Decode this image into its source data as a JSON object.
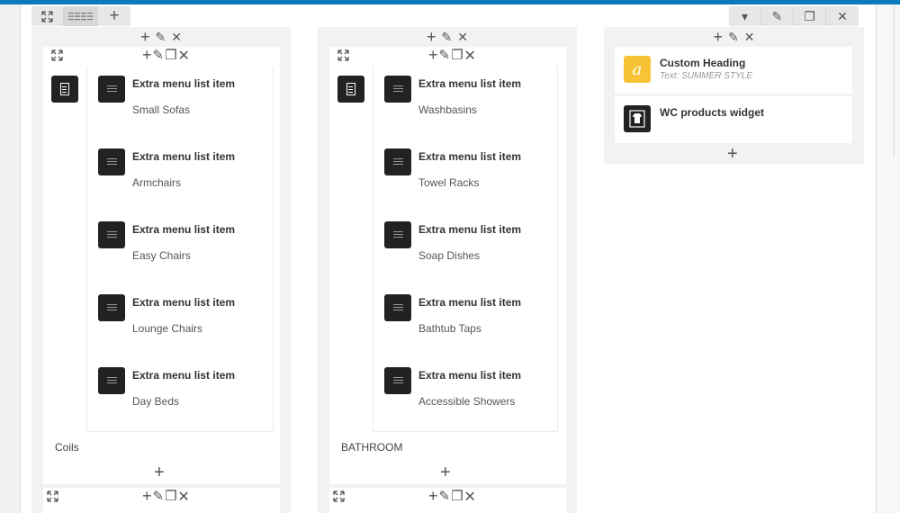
{
  "row_controls_left": {
    "expand_icon": "expand-icon",
    "layout_icon": "layout-icon",
    "add_icon": "+"
  },
  "row_controls_right": {
    "dropdown_icon": "▾",
    "edit_icon": "✎",
    "clone_icon": "❐",
    "delete_icon": "✕"
  },
  "tool_glyphs": {
    "add": "+",
    "edit": "✎",
    "clone": "❐",
    "delete": "✕",
    "expand": "⤢"
  },
  "columns": [
    {
      "title": "Coils",
      "items": [
        {
          "title": "Extra menu list item",
          "subtitle": "Small Sofas"
        },
        {
          "title": "Extra menu list item",
          "subtitle": "Armchairs"
        },
        {
          "title": "Extra menu list item",
          "subtitle": "Easy Chairs"
        },
        {
          "title": "Extra menu list item",
          "subtitle": "Lounge Chairs"
        },
        {
          "title": "Extra menu list item",
          "subtitle": "Day Beds"
        }
      ]
    },
    {
      "title": "BATHROOM",
      "items": [
        {
          "title": "Extra menu list item",
          "subtitle": "Washbasins"
        },
        {
          "title": "Extra menu list item",
          "subtitle": "Towel Racks"
        },
        {
          "title": "Extra menu list item",
          "subtitle": "Soap Dishes"
        },
        {
          "title": "Extra menu list item",
          "subtitle": "Bathtub Taps"
        },
        {
          "title": "Extra menu list item",
          "subtitle": "Accessible Showers"
        }
      ]
    }
  ],
  "widgets": [
    {
      "title": "Custom Heading",
      "subtitle": "Text: SUMMER STYLE",
      "icon": "custom-heading-icon",
      "glyph": "a",
      "color": "#f7c234"
    },
    {
      "title": "WC products widget",
      "subtitle": "",
      "icon": "wc-products-icon",
      "glyph": "",
      "color": "#222222"
    }
  ],
  "colors": {
    "accent": "#0a7bbd"
  }
}
